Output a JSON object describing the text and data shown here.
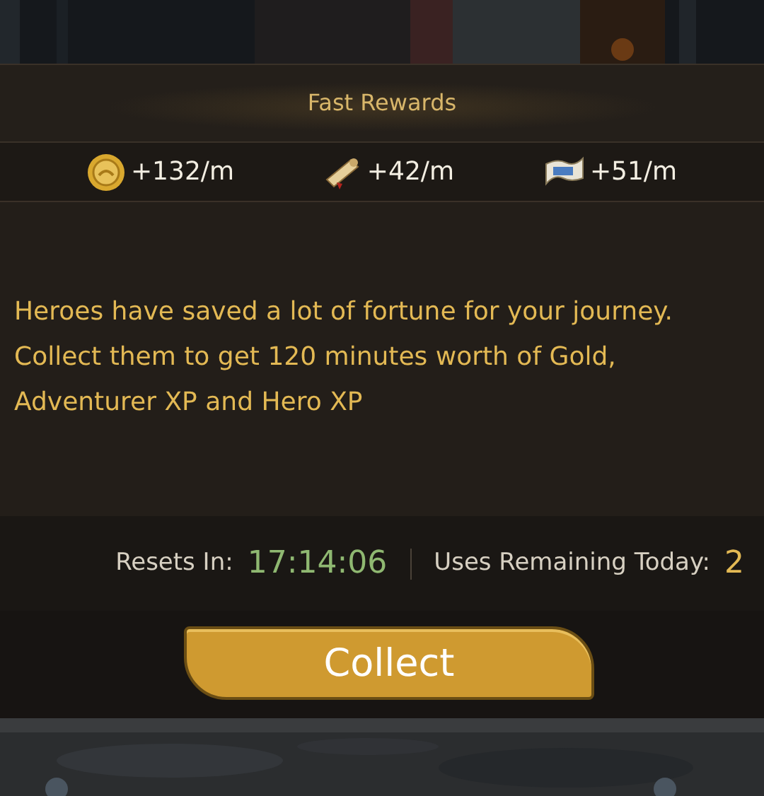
{
  "title": "Fast Rewards",
  "rewards": [
    {
      "kind": "gold",
      "amount": "+132/m"
    },
    {
      "kind": "adventurer_xp",
      "amount": "+42/m"
    },
    {
      "kind": "hero_xp",
      "amount": "+51/m"
    }
  ],
  "description": "Heroes have saved a lot of fortune for your journey. Collect them to get 120 minutes worth of Gold, Adventurer XP and Hero XP",
  "resets": {
    "label": "Resets In:",
    "value": "17:14:06"
  },
  "uses": {
    "label": "Uses Remaining Today:",
    "value": "2"
  },
  "button": "Collect"
}
